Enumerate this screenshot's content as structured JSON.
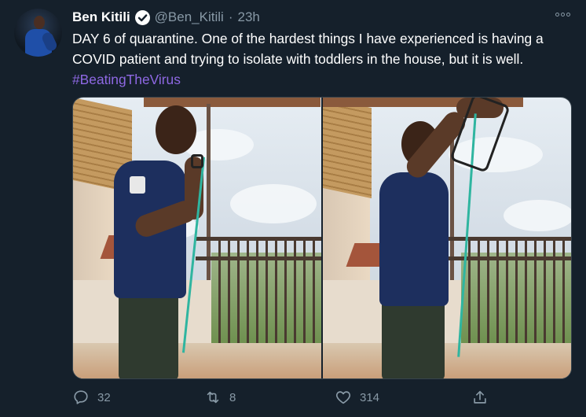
{
  "user": {
    "name": "Ben Kitili",
    "handle": "@Ben_Kitili",
    "separator": "·",
    "time": "23h",
    "verified": true
  },
  "tweet": {
    "text": "DAY 6 of quarantine. One of the hardest things I have experienced is having a COVID patient and trying to isolate with toddlers in the house, but it is well. ",
    "hashtag": "#BeatingTheVirus"
  },
  "media": {
    "photos": [
      {
        "alt_icon": "photo-exercise-band-left"
      },
      {
        "alt_icon": "photo-exercise-band-right"
      }
    ]
  },
  "actions": {
    "reply": {
      "icon": "reply-icon",
      "count": "32"
    },
    "retweet": {
      "icon": "retweet-icon",
      "count": "8"
    },
    "like": {
      "icon": "heart-icon",
      "count": "314"
    },
    "share": {
      "icon": "share-icon"
    }
  },
  "colors": {
    "background": "#15202b",
    "secondary_text": "#8899a6",
    "hashtag": "#8e68e3",
    "border": "#38444d"
  }
}
